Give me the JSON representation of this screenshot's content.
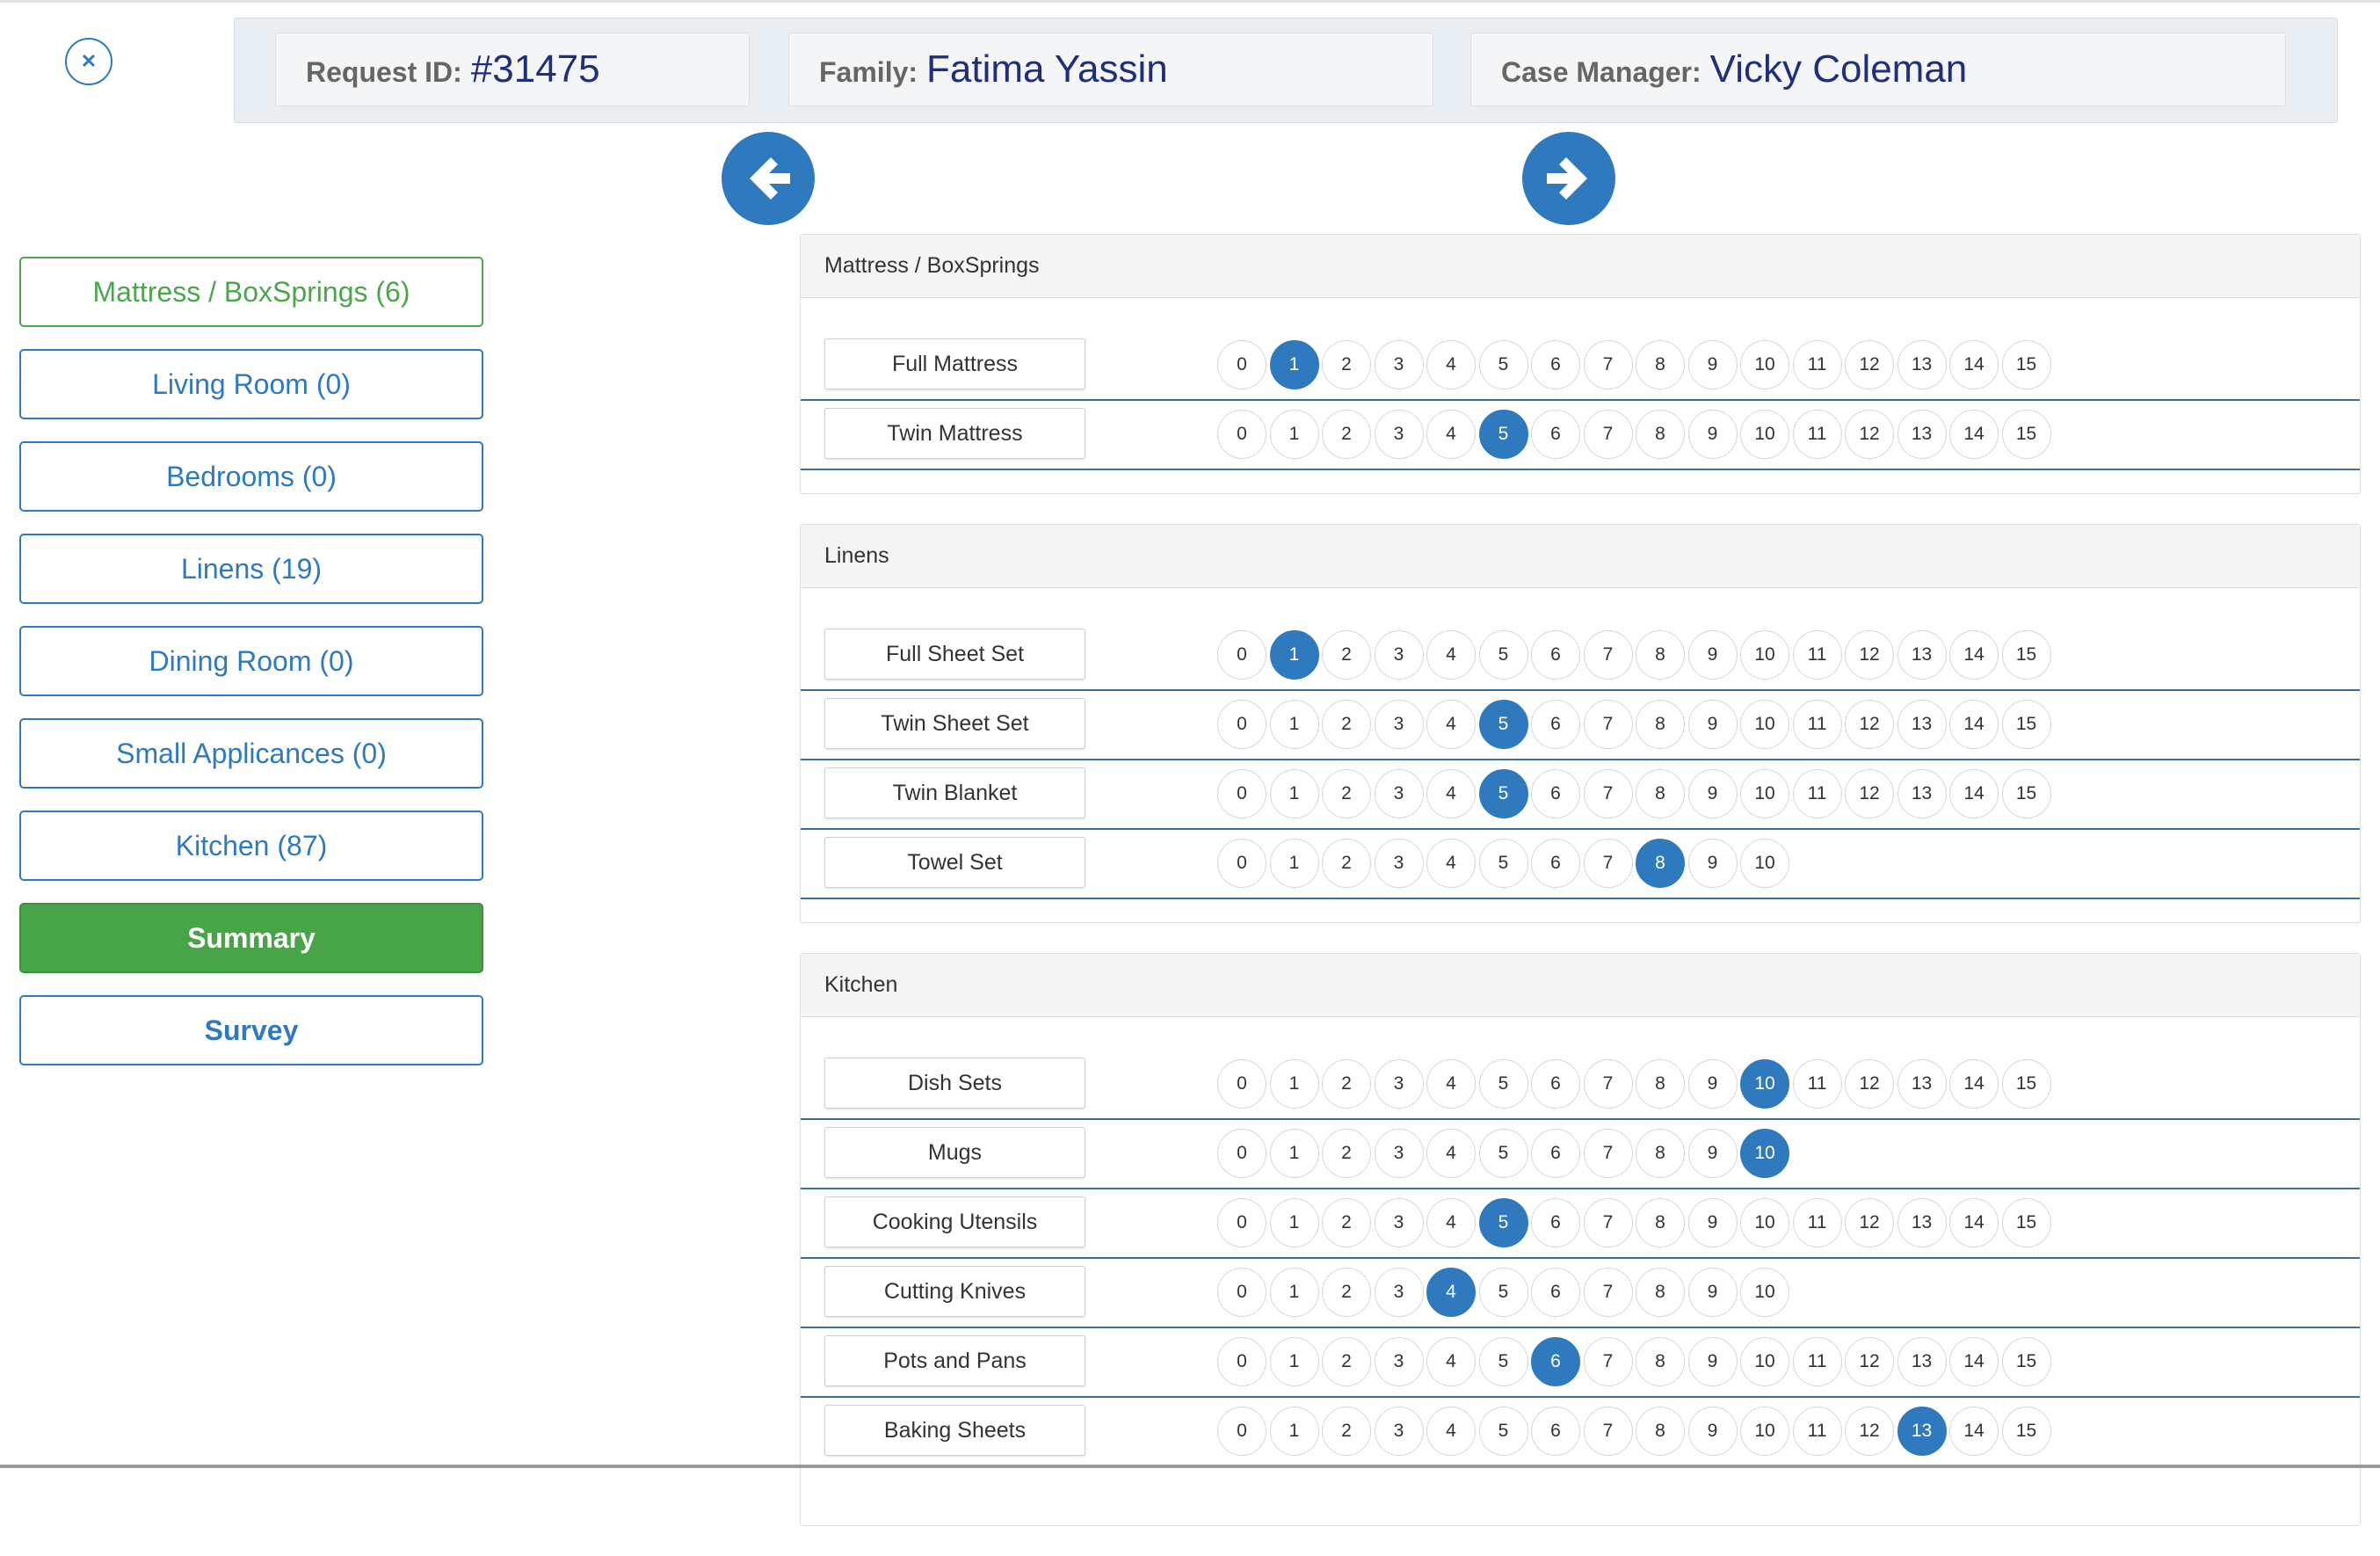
{
  "header": {
    "request_label": "Request ID:",
    "request_id": "#31475",
    "family_label": "Family:",
    "family_name": "Fatima Yassin",
    "manager_label": "Case Manager:",
    "manager_name": "Vicky Coleman"
  },
  "close_icon": "close-icon",
  "colors": {
    "accent": "#2f7abf",
    "success": "#47a447",
    "header_bg": "#e8eef2",
    "row_divider": "#3a6f9e"
  },
  "sidebar": {
    "items": [
      {
        "label": "Mattress / BoxSprings (6)"
      },
      {
        "label": "Living Room (0)"
      },
      {
        "label": "Bedrooms (0)"
      },
      {
        "label": "Linens (19)"
      },
      {
        "label": "Dining Room (0)"
      },
      {
        "label": "Small Applicances (0)"
      },
      {
        "label": "Kitchen (87)"
      },
      {
        "label": "Summary"
      },
      {
        "label": "Survey"
      }
    ]
  },
  "sections": [
    {
      "title": "Mattress / BoxSprings",
      "items": [
        {
          "name": "Full Mattress",
          "max": 15,
          "selected": 1
        },
        {
          "name": "Twin Mattress",
          "max": 15,
          "selected": 5
        }
      ]
    },
    {
      "title": "Linens",
      "items": [
        {
          "name": "Full Sheet Set",
          "max": 15,
          "selected": 1
        },
        {
          "name": "Twin Sheet Set",
          "max": 15,
          "selected": 5
        },
        {
          "name": "Twin Blanket",
          "max": 15,
          "selected": 5
        },
        {
          "name": "Towel Set",
          "max": 10,
          "selected": 8
        }
      ]
    },
    {
      "title": "Kitchen",
      "items": [
        {
          "name": "Dish Sets",
          "max": 15,
          "selected": 10
        },
        {
          "name": "Mugs",
          "max": 10,
          "selected": 10
        },
        {
          "name": "Cooking Utensils",
          "max": 15,
          "selected": 5
        },
        {
          "name": "Cutting Knives",
          "max": 10,
          "selected": 4
        },
        {
          "name": "Pots and Pans",
          "max": 15,
          "selected": 6
        },
        {
          "name": "Baking Sheets",
          "max": 15,
          "selected": 13
        }
      ]
    }
  ]
}
